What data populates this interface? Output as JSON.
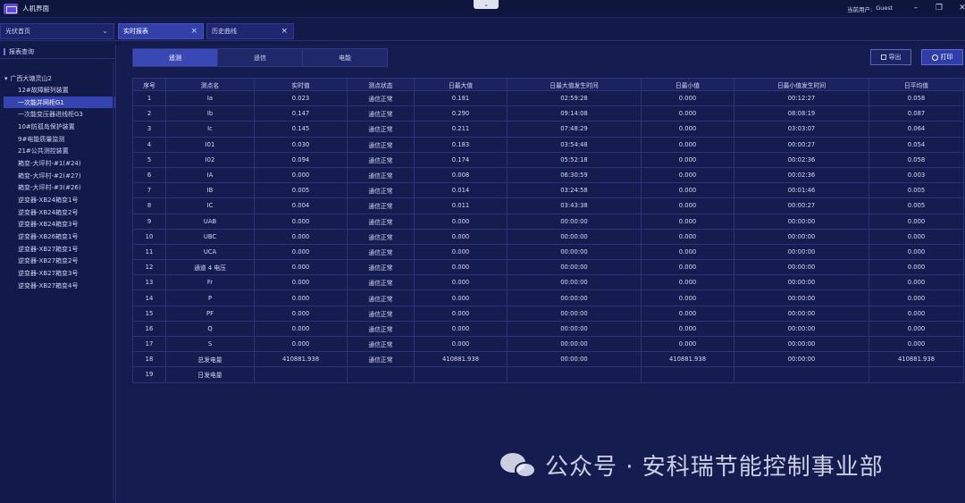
{
  "window": {
    "title": "人机界面",
    "user_label": "当前用户:",
    "user_name": "Guest"
  },
  "colors": {
    "background": "#121a4a",
    "accent": "#3444b0",
    "border": "#2a3477"
  },
  "tabs": {
    "home": "光伏首页",
    "items": [
      {
        "label": "实时报表",
        "active": true
      },
      {
        "label": "历史曲线",
        "active": false
      }
    ]
  },
  "sidebar": {
    "header": "报表查询",
    "root": "广西大塘灵山2",
    "items": [
      "12#故障解列装置",
      "一次能并网柜G1",
      "一次能变压器进线柜G3",
      "10#防孤岛保护装置",
      "9#电能质量监测",
      "21#公共测控装置",
      "箱变-大坪村-#1(#24)",
      "箱变-大坪村-#2(#27)",
      "箱变-大坪村-#3(#26)",
      "逆变器-XB24箱变1号",
      "逆变器-XB24箱变2号",
      "逆变器-XB24箱变3号",
      "逆变器-XB26箱变1号",
      "逆变器-XB27箱变1号",
      "逆变器-XB27箱变2号",
      "逆变器-XB27箱变3号",
      "逆变器-XB27箱变4号"
    ],
    "selected_index": 1
  },
  "segments": {
    "items": [
      "遥测",
      "遥信",
      "电能"
    ],
    "active": 0
  },
  "toolbar": {
    "export_label": "导出",
    "print_label": "打印"
  },
  "table": {
    "columns": [
      "序号",
      "测点名",
      "实时值",
      "测点状态",
      "日最大值",
      "日最大值发生时间",
      "日最小值",
      "日最小值发生时间",
      "日平均值"
    ],
    "rows": [
      [
        "1",
        "Ia",
        "0.023",
        "通信正常",
        "0.181",
        "02:59:28",
        "0.000",
        "00:12:27",
        "0.058"
      ],
      [
        "2",
        "Ib",
        "0.147",
        "通信正常",
        "0.290",
        "09:14:08",
        "0.000",
        "08:08:19",
        "0.087"
      ],
      [
        "3",
        "Ic",
        "0.145",
        "通信正常",
        "0.211",
        "07:48:29",
        "0.000",
        "03:03:07",
        "0.064"
      ],
      [
        "4",
        "I01",
        "0.030",
        "通信正常",
        "0.183",
        "03:54:48",
        "0.000",
        "00:00:27",
        "0.054"
      ],
      [
        "5",
        "I02",
        "0.094",
        "通信正常",
        "0.174",
        "05:52:18",
        "0.000",
        "00:02:36",
        "0.058"
      ],
      [
        "6",
        "IA",
        "0.000",
        "通信正常",
        "0.008",
        "06:30:59",
        "0.000",
        "00:02:36",
        "0.003"
      ],
      [
        "7",
        "IB",
        "0.005",
        "通信正常",
        "0.014",
        "03:24:58",
        "0.000",
        "00:01:46",
        "0.005"
      ],
      [
        "8",
        "IC",
        "0.004",
        "通信正常",
        "0.011",
        "03:43:38",
        "0.000",
        "00:00:27",
        "0.005"
      ],
      [
        "9",
        "UAB",
        "0.000",
        "通信正常",
        "0.000",
        "00:00:00",
        "0.000",
        "00:00:00",
        "0.000"
      ],
      [
        "10",
        "UBC",
        "0.000",
        "通信正常",
        "0.000",
        "00:00:00",
        "0.000",
        "00:00:00",
        "0.000"
      ],
      [
        "11",
        "UCA",
        "0.000",
        "通信正常",
        "0.000",
        "00:00:00",
        "0.000",
        "00:00:00",
        "0.000"
      ],
      [
        "12",
        "通道 4 电压",
        "0.000",
        "通信正常",
        "0.000",
        "00:00:00",
        "0.000",
        "00:00:00",
        "0.000"
      ],
      [
        "13",
        "Fr",
        "0.000",
        "通信正常",
        "0.000",
        "00:00:00",
        "0.000",
        "00:00:00",
        "0.000"
      ],
      [
        "14",
        "P",
        "0.000",
        "通信正常",
        "0.000",
        "00:00:00",
        "0.000",
        "00:00:00",
        "0.000"
      ],
      [
        "15",
        "PF",
        "0.000",
        "通信正常",
        "0.000",
        "00:00:00",
        "0.000",
        "00:00:00",
        "0.000"
      ],
      [
        "16",
        "Q",
        "0.000",
        "通信正常",
        "0.000",
        "00:00:00",
        "0.000",
        "00:00:00",
        "0.000"
      ],
      [
        "17",
        "S",
        "0.000",
        "通信正常",
        "0.000",
        "00:00:00",
        "0.000",
        "00:00:00",
        "0.000"
      ],
      [
        "18",
        "总发电量",
        "410881.938",
        "通信正常",
        "410881.938",
        "00:00:00",
        "410881.938",
        "00:00:00",
        "410881.938"
      ],
      [
        "19",
        "日发电量",
        "",
        "",
        "",
        "",
        "",
        "",
        ""
      ]
    ]
  },
  "watermark": {
    "text": "公众号 · 安科瑞节能控制事业部"
  }
}
